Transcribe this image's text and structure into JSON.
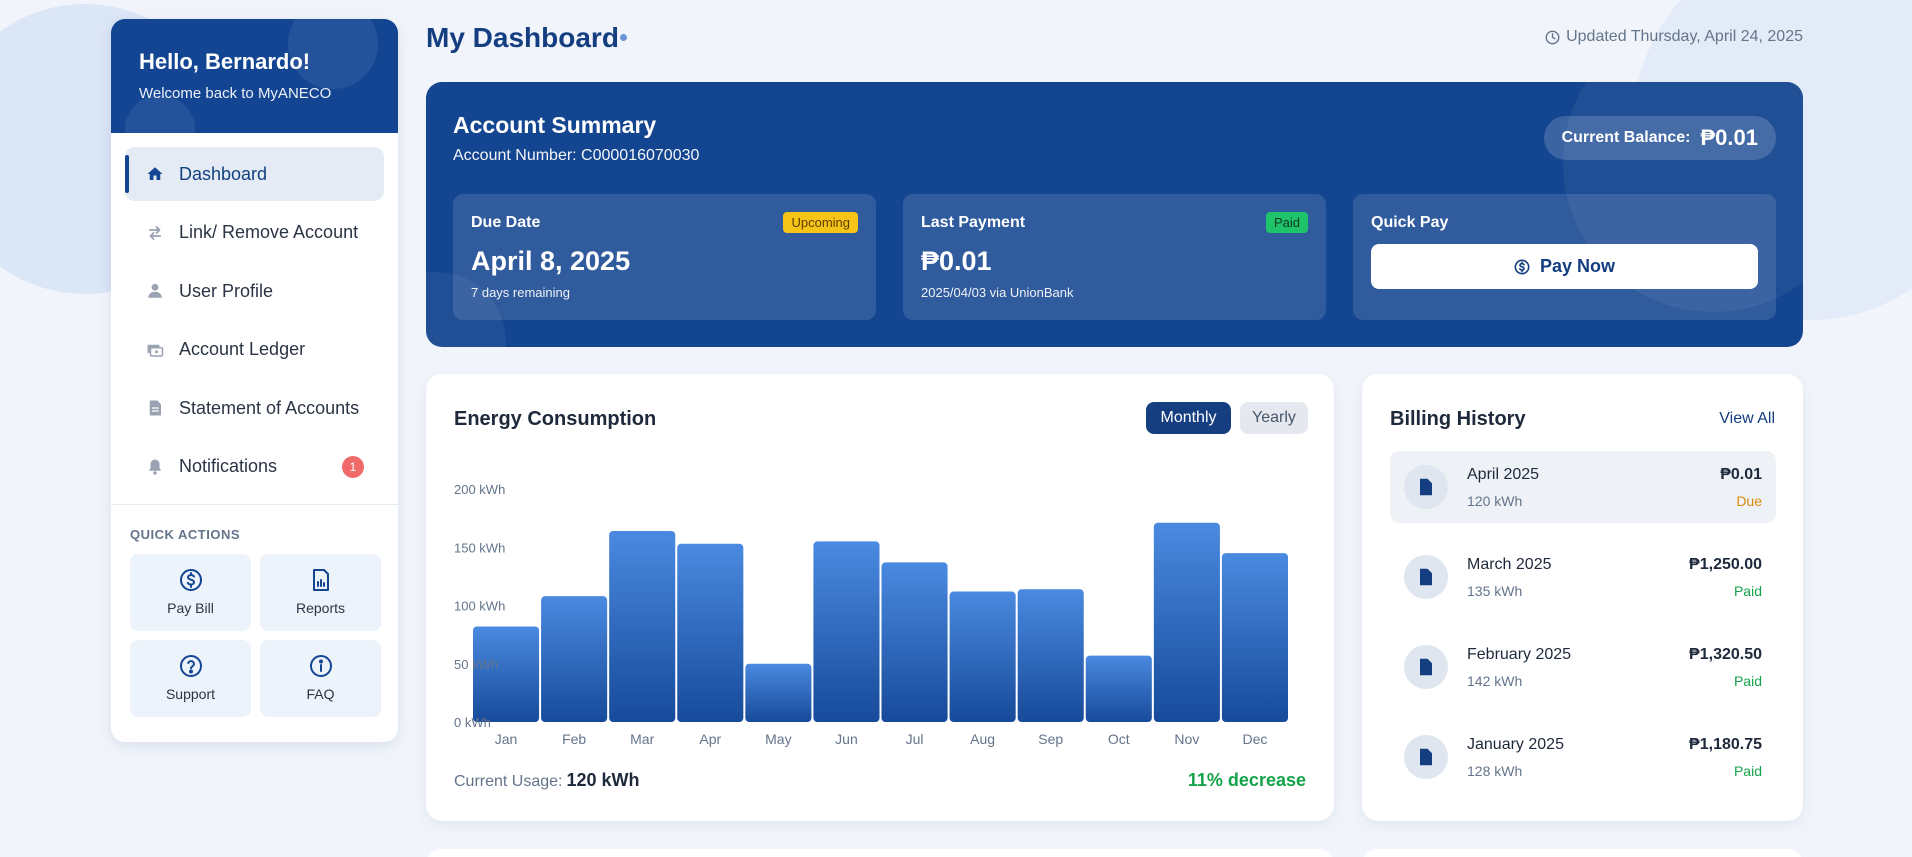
{
  "sidebar": {
    "greeting": "Hello, Bernardo!",
    "subtitle": "Welcome back to MyANECO",
    "items": [
      {
        "label": "Dashboard",
        "icon": "home-icon",
        "active": true
      },
      {
        "label": "Link/ Remove Account",
        "icon": "swap-arrows-icon"
      },
      {
        "label": "User Profile",
        "icon": "user-icon"
      },
      {
        "label": "Account Ledger",
        "icon": "ledger-icon"
      },
      {
        "label": "Statement of Accounts",
        "icon": "document-icon"
      },
      {
        "label": "Notifications",
        "icon": "bell-icon",
        "badge": "1"
      }
    ],
    "quick_actions_title": "QUICK ACTIONS",
    "quick_actions": [
      {
        "label": "Pay Bill",
        "icon": "dollar-circle-icon"
      },
      {
        "label": "Reports",
        "icon": "report-icon"
      },
      {
        "label": "Support",
        "icon": "question-circle-icon"
      },
      {
        "label": "FAQ",
        "icon": "info-circle-icon"
      }
    ]
  },
  "header": {
    "title": "My Dashboard",
    "updated": "Updated Thursday, April 24, 2025"
  },
  "summary": {
    "title": "Account Summary",
    "account_number": "Account Number: C000016070030",
    "balance_label": "Current Balance:",
    "balance_value": "₱0.01",
    "due": {
      "label": "Due Date",
      "tag": "Upcoming",
      "value": "April 8, 2025",
      "note": "7 days remaining"
    },
    "last_payment": {
      "label": "Last Payment",
      "tag": "Paid",
      "value": "₱0.01",
      "note": "2025/04/03 via UnionBank"
    },
    "quick_pay": {
      "label": "Quick Pay",
      "button": "Pay Now"
    }
  },
  "energy": {
    "title": "Energy Consumption",
    "toggle_monthly": "Monthly",
    "toggle_yearly": "Yearly",
    "usage_label": "Current Usage:",
    "usage_value": "120 kWh",
    "change": "11% decrease"
  },
  "chart_data": {
    "type": "bar",
    "categories": [
      "Jan",
      "Feb",
      "Mar",
      "Apr",
      "May",
      "Jun",
      "Jul",
      "Aug",
      "Sep",
      "Oct",
      "Nov",
      "Dec"
    ],
    "values": [
      82,
      108,
      164,
      153,
      50,
      155,
      137,
      112,
      114,
      57,
      171,
      145
    ],
    "ylim": [
      0,
      200
    ],
    "yticks": [
      "0 kWh",
      "50 kWh",
      "100 kWh",
      "150 kWh",
      "200 kWh"
    ],
    "ytick_values": [
      0,
      50,
      100,
      150,
      200
    ],
    "bar_color": "#3b78d4",
    "grid": false
  },
  "billing": {
    "title": "Billing History",
    "view_all": "View All",
    "rows": [
      {
        "month": "April 2025",
        "kwh": "120 kWh",
        "amount": "₱0.01",
        "status": "Due"
      },
      {
        "month": "March 2025",
        "kwh": "135 kWh",
        "amount": "₱1,250.00",
        "status": "Paid"
      },
      {
        "month": "February 2025",
        "kwh": "142 kWh",
        "amount": "₱1,320.50",
        "status": "Paid"
      },
      {
        "month": "January 2025",
        "kwh": "128 kWh",
        "amount": "₱1,180.75",
        "status": "Paid"
      }
    ]
  },
  "colors": {
    "primary": "#134593",
    "accent_bar": "#3b78d4",
    "paid": "#14a34a",
    "due": "#d88a07",
    "badge": "#f16a6a"
  }
}
